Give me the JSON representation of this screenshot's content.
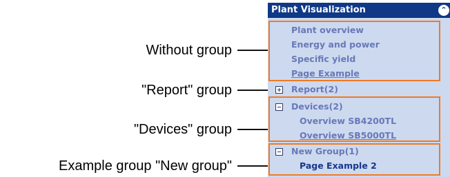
{
  "annotations": {
    "without_group": "Without group",
    "report_group": "\"Report\" group",
    "devices_group": "\"Devices\" group",
    "example_group": "Example group \"New group\""
  },
  "panel": {
    "title": "Plant Visualization",
    "collapse_icon": "double-chevron-up-icon",
    "ungrouped_items": [
      "Plant overview",
      "Energy and power",
      "Specific yield",
      "Page Example"
    ],
    "groups": [
      {
        "label": "Report(2)",
        "state": "collapsed",
        "items": []
      },
      {
        "label": "Devices(2)",
        "state": "expanded",
        "items": [
          "Overview SB4200TL",
          "Overview SB5000TL"
        ]
      },
      {
        "label": "New Group(1)",
        "state": "expanded",
        "items": [
          "Page Example 2"
        ]
      }
    ]
  },
  "colors": {
    "header_bg": "#0f3886",
    "panel_bg": "#cdd9ef",
    "item_text": "#6779b8",
    "active_item_text": "#17378d",
    "highlight_border": "#f07a20"
  }
}
